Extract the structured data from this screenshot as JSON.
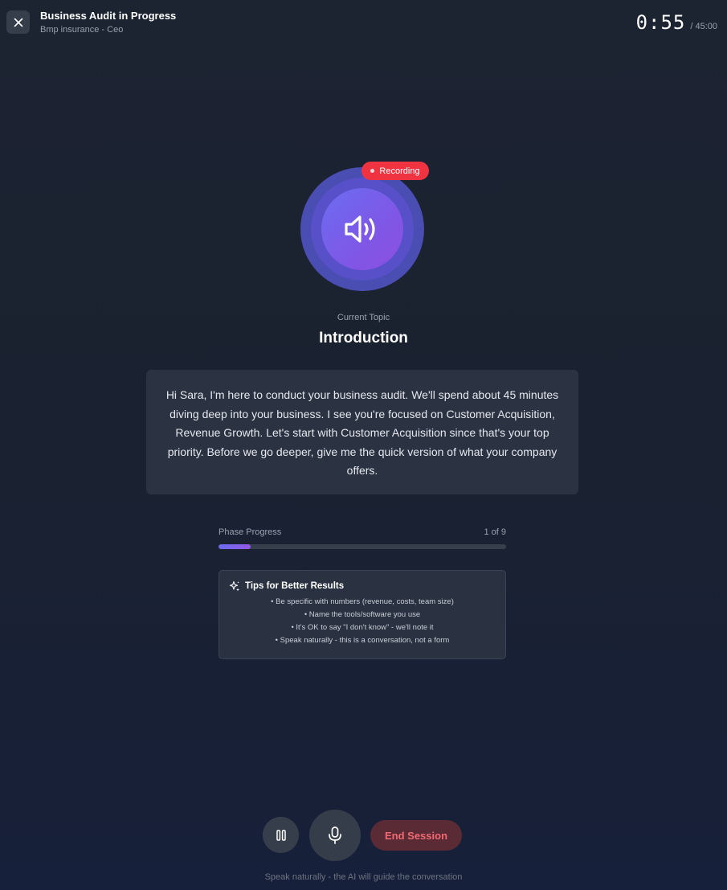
{
  "header": {
    "title": "Business Audit in Progress",
    "subtitle": "Bmp insurance - Ceo",
    "timer_elapsed": "0:55",
    "timer_total": "/ 45:00"
  },
  "recording": {
    "label": "Recording",
    "color": "#ef3340"
  },
  "topic": {
    "label": "Current Topic",
    "title": "Introduction"
  },
  "message": "Hi Sara, I'm here to conduct your business audit. We'll spend about 45 minutes diving deep into your business. I see you're focused on Customer Acquisition, Revenue Growth. Let's start with Customer Acquisition since that's your top priority. Before we go deeper, give me the quick version of what your company offers.",
  "phase": {
    "label": "Phase Progress",
    "count": "1 of 9",
    "current": 1,
    "total": 9
  },
  "tips": {
    "title": "Tips for Better Results",
    "items": [
      "• Be specific with numbers (revenue, costs, team size)",
      "• Name the tools/software you use",
      "• It's OK to say \"I don't know\" - we'll note it",
      "• Speak naturally - this is a conversation, not a form"
    ]
  },
  "controls": {
    "end_label": "End Session",
    "hint": "Speak naturally - the AI will guide the conversation"
  },
  "icons": {
    "close": "close-icon",
    "speaker": "speaker-icon",
    "sparkle": "sparkle-icon",
    "pause": "pause-icon",
    "mic": "microphone-icon"
  }
}
